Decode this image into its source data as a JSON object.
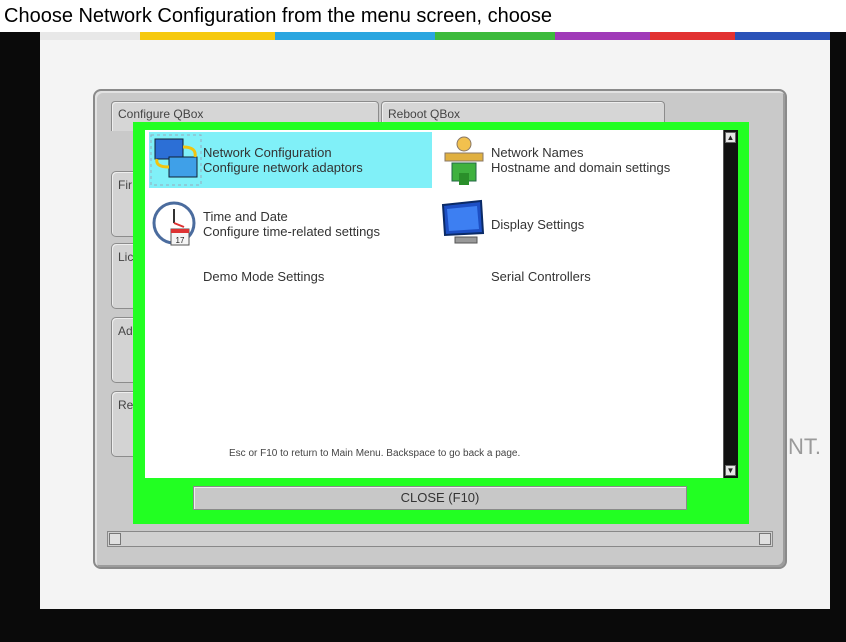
{
  "caption": "Choose Network Configuration from the menu screen, choose",
  "background": {
    "right_text": "NT."
  },
  "tabs": {
    "top": [
      "Configure QBox",
      "Reboot QBox"
    ],
    "side": [
      "Fir",
      "Lic",
      "Ad",
      "Re"
    ]
  },
  "menu": {
    "items": [
      {
        "title": "Network Configuration",
        "subtitle": "Configure network adaptors",
        "icon": "network-adapters-icon",
        "selected": true
      },
      {
        "title": "Network Names",
        "subtitle": "Hostname and domain settings",
        "icon": "network-names-icon",
        "selected": false
      },
      {
        "title": "Time and Date",
        "subtitle": "Configure time-related settings",
        "icon": "clock-calendar-icon",
        "selected": false
      },
      {
        "title": "Display Settings",
        "subtitle": "",
        "icon": "monitor-icon",
        "selected": false
      },
      {
        "title": "Demo Mode Settings",
        "subtitle": "",
        "icon": "",
        "selected": false
      },
      {
        "title": "Serial Controllers",
        "subtitle": "",
        "icon": "",
        "selected": false
      }
    ],
    "footer": "Esc or F10 to return to Main Menu. Backspace to go back a page.",
    "close_label": "CLOSE (F10)"
  },
  "colors": {
    "frame": "#22ff22",
    "selection": "#80f0f8",
    "stripes": [
      "#f6c90e",
      "#2aa6e0",
      "#3dbb3d",
      "#a03ab8",
      "#e23131",
      "#2a52b8"
    ]
  }
}
